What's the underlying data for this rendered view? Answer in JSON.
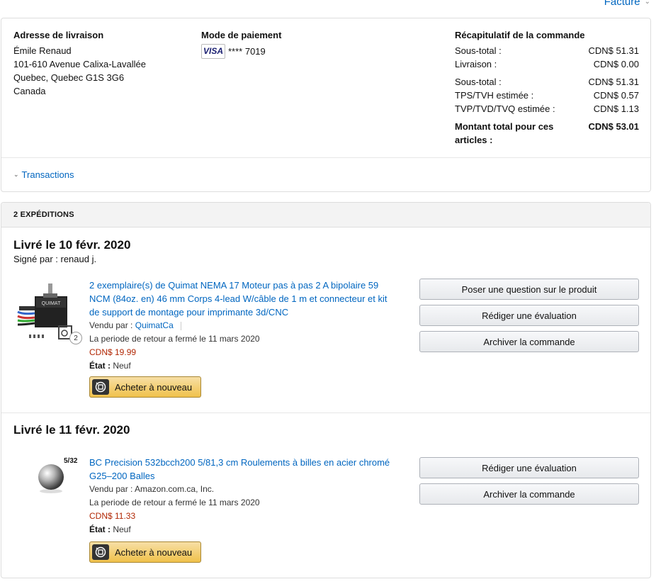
{
  "header": {
    "invoice_label": "Facture"
  },
  "address": {
    "heading": "Adresse de livraison",
    "name": "Émile Renaud",
    "line1": "101-610 Avenue Calixa-Lavallée",
    "line2": "Quebec, Quebec G1S 3G6",
    "country": "Canada"
  },
  "payment": {
    "heading": "Mode de paiement",
    "card_brand": "VISA",
    "card_digits": "**** 7019"
  },
  "summary": {
    "heading": "Récapitulatif de la commande",
    "rows": [
      {
        "label": "Sous-total :",
        "value": "CDN$ 51.31"
      },
      {
        "label": "Livraison :",
        "value": "CDN$ 0.00"
      },
      {
        "label": "Sous-total :",
        "value": "CDN$ 51.31"
      },
      {
        "label": "TPS/TVH estimée :",
        "value": "CDN$ 0.57"
      },
      {
        "label": "TVP/TVD/TVQ estimée :",
        "value": "CDN$ 1.13"
      }
    ],
    "total_label": "Montant total pour ces articles :",
    "total_value": "CDN$ 53.01"
  },
  "transactions_label": "Transactions",
  "shipments_heading": "2 EXPÉDITIONS",
  "shipments": [
    {
      "delivered": "Livré le 10 févr. 2020",
      "signed": "Signé par : renaud j.",
      "qty": "2",
      "title": "2 exemplaire(s) de Quimat NEMA 17 Moteur pas à pas 2 A bipolaire 59 NCM (84oz. en) 46 mm Corps 4-lead W/câble de 1 m et connecteur et kit de support de montage pour imprimante 3d/CNC",
      "sold_by_label": "Vendu par :",
      "seller": "QuimatCa",
      "brand_label": "QUIMAT",
      "return": "La periode de retour a fermé le 11 mars 2020",
      "price": "CDN$ 19.99",
      "cond_label": "État :",
      "cond": "Neuf",
      "buy_again": "Acheter à nouveau",
      "buttons": [
        "Poser une question sur le produit",
        "Rédiger une évaluation",
        "Archiver la commande"
      ]
    },
    {
      "delivered": "Livré le 11 févr. 2020",
      "image_label": "5/32",
      "title": "BC Precision 532bcch200 5/81,3 cm Roulements à billes en acier chromé G25–200 Balles",
      "sold_by": "Vendu par : Amazon.com.ca, Inc.",
      "return": "La periode de retour a fermé le 11 mars 2020",
      "price": "CDN$ 11.33",
      "cond_label": "État :",
      "cond": "Neuf",
      "buy_again": "Acheter à nouveau",
      "buttons": [
        "Rédiger une évaluation",
        "Archiver la commande"
      ]
    }
  ]
}
